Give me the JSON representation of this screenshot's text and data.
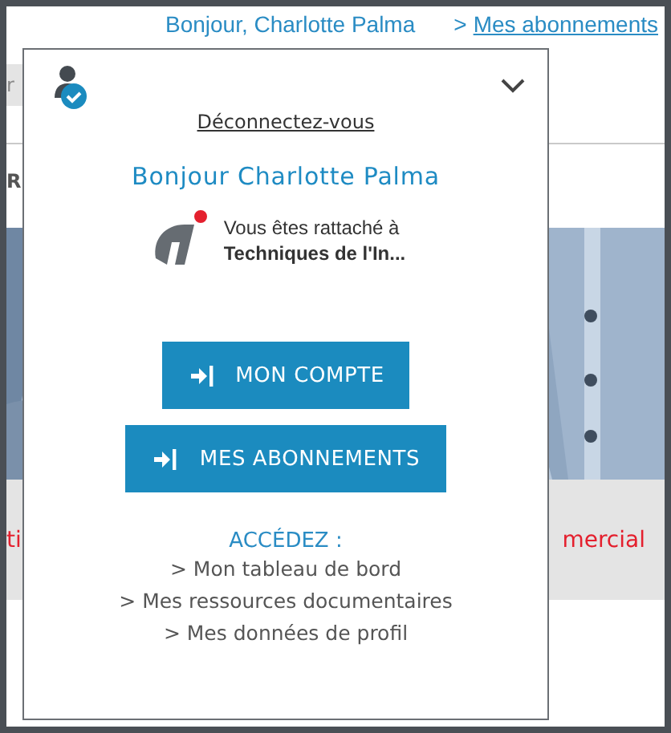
{
  "header": {
    "greeting": "Bonjour, Charlotte Palma",
    "link_prefix": ">",
    "link": "Mes abonnements"
  },
  "background": {
    "search_fragment": "r",
    "heading_fragment": "R",
    "banner_left_fragment": "ti",
    "banner_right_fragment": "mercial"
  },
  "popup": {
    "logout_link": "Déconnectez-vous",
    "greeting": "Bonjour Charlotte Palma",
    "affiliation": {
      "line_1": "Vous êtes rattaché à",
      "organization": "Techniques de l'In..."
    },
    "buttons": [
      "MON COMPTE",
      "MES ABONNEMENTS"
    ],
    "access_heading": "ACCÉDEZ :",
    "links": [
      "> Mon tableau de bord",
      "> Mes ressources documentaires",
      "> Mes données de profil"
    ]
  }
}
